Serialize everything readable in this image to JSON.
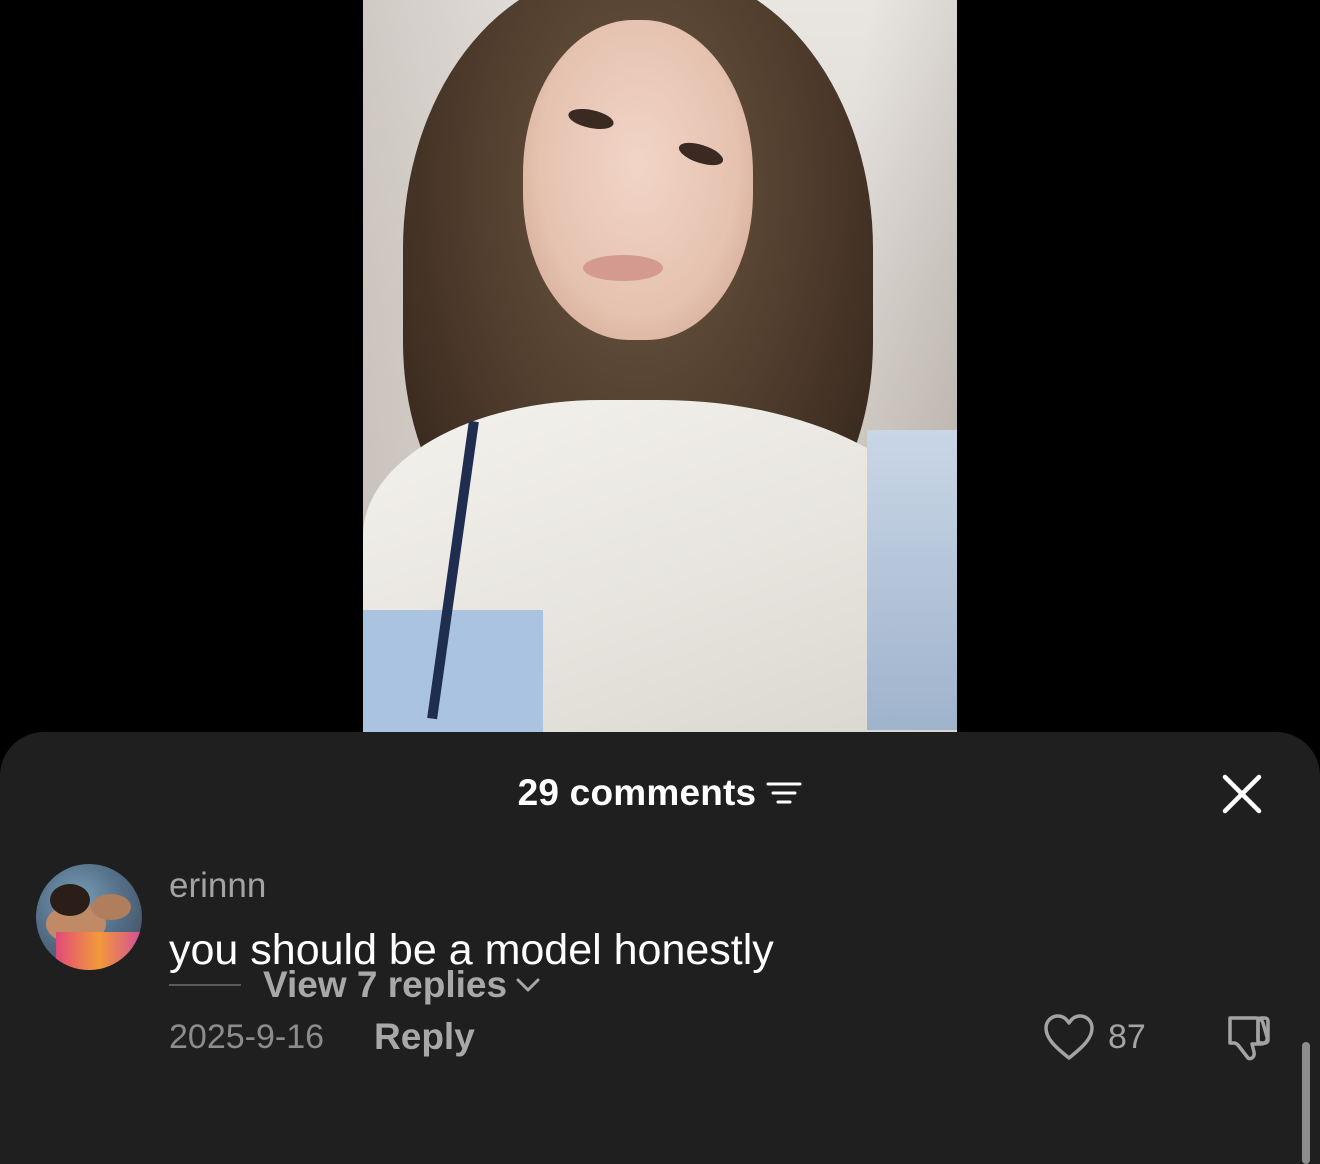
{
  "header": {
    "comments_count_label": "29 comments",
    "filter_icon": "filter-icon",
    "close_icon": "close-icon"
  },
  "comment": {
    "username": "erinnn",
    "text": "you should be a model honestly",
    "date": "2025-9-16",
    "reply_label": "Reply",
    "like_count": "87",
    "like_icon": "heart-icon",
    "dislike_icon": "thumbs-down-icon",
    "view_replies_label": "View 7 replies",
    "view_replies_icon": "chevron-down-icon"
  },
  "colors": {
    "sheet_bg": "#1f1f1f",
    "page_bg": "#000000",
    "primary_text": "#ffffff",
    "secondary_text": "#a3a3a3"
  }
}
